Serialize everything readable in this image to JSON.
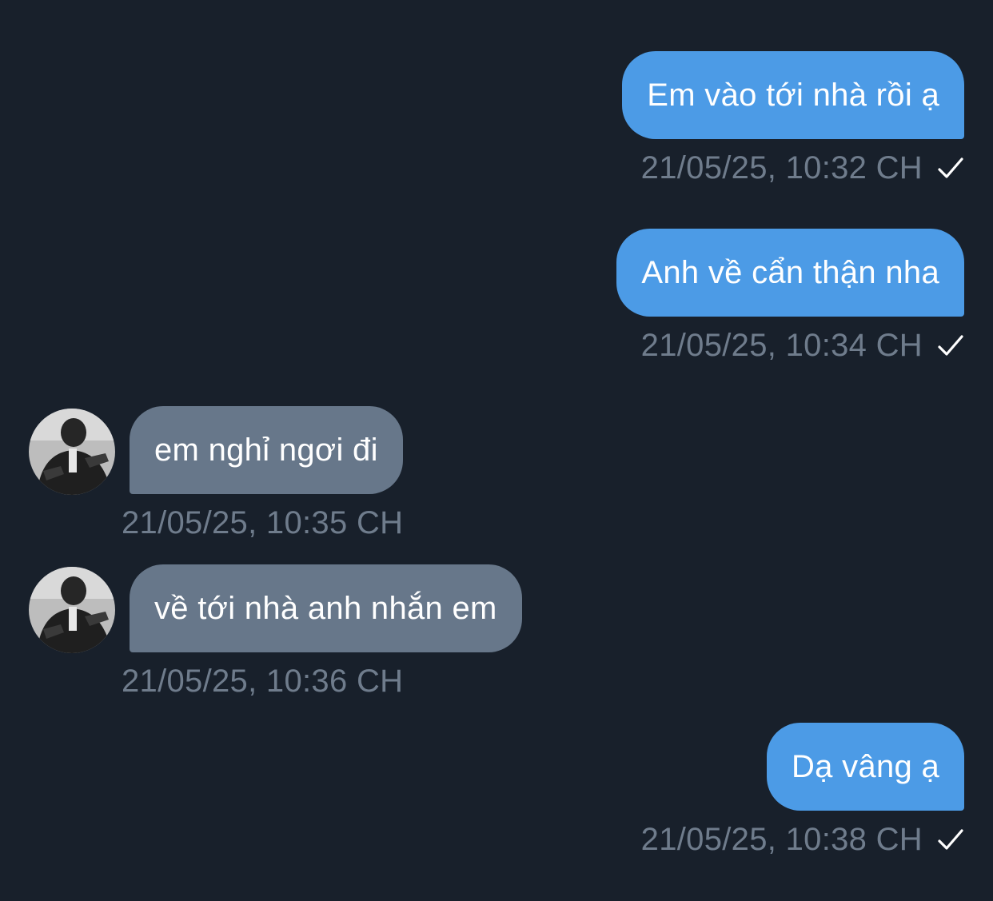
{
  "messages": [
    {
      "direction": "out",
      "text": "Em vào tới nhà rồi ạ",
      "time": "21/05/25, 10:32 CH",
      "status_icon": "checkmark-icon"
    },
    {
      "direction": "out",
      "text": "Anh về cẩn thận nha",
      "time": "21/05/25, 10:34 CH",
      "status_icon": "checkmark-icon"
    },
    {
      "direction": "in",
      "text": "em nghỉ ngơi đi",
      "time": "21/05/25, 10:35 CH",
      "avatar": "contact-avatar"
    },
    {
      "direction": "in",
      "text": "về tới nhà anh nhắn em",
      "time": "21/05/25, 10:36 CH",
      "avatar": "contact-avatar"
    },
    {
      "direction": "out",
      "text": "Dạ vâng ạ",
      "time": "21/05/25, 10:38 CH",
      "status_icon": "checkmark-icon"
    }
  ],
  "colors": {
    "background": "#18202b",
    "outgoing_bubble": "#4c9be6",
    "incoming_bubble": "#67778a",
    "timestamp": "#6f7c8c",
    "text": "#ffffff"
  }
}
